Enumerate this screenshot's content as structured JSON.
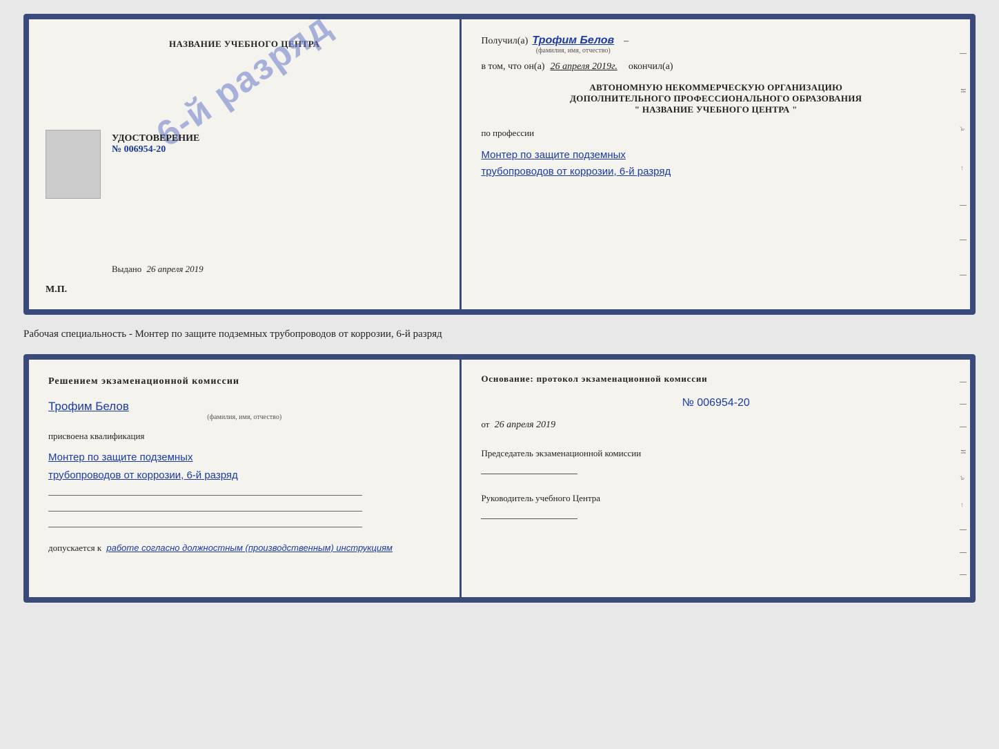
{
  "top_cert": {
    "left": {
      "school_name": "НАЗВАНИЕ УЧЕБНОГО ЦЕНТРА",
      "stamp_text": "6-й разряд",
      "udost_label": "УДОСТОВЕРЕНИЕ",
      "udost_num": "№ 006954-20",
      "vydano_label": "Выдано",
      "vydano_date": "26 апреля 2019",
      "mp_label": "М.П."
    },
    "right": {
      "poluchil_label": "Получил(а)",
      "poluchil_name": "Трофим Белов",
      "fio_sub": "(фамилия, имя, отчество)",
      "vtom_label": "в том, что он(а)",
      "vtom_date": "26 апреля 2019г.",
      "okonchil": "окончил(а)",
      "org_line1": "АВТОНОМНУЮ НЕКОММЕРЧЕСКУЮ ОРГАНИЗАЦИЮ",
      "org_line2": "ДОПОЛНИТЕЛЬНОГО ПРОФЕССИОНАЛЬНОГО ОБРАЗОВАНИЯ",
      "org_line3": "\"  НАЗВАНИЕ УЧЕБНОГО ЦЕНТРА  \"",
      "po_professii": "по профессии",
      "profession_line1": "Монтер по защите подземных",
      "profession_line2": "трубопроводов от коррозии, 6-й разряд"
    }
  },
  "worker_specialty": "Рабочая специальность - Монтер по защите подземных трубопроводов от коррозии, 6-й разряд",
  "bottom_cert": {
    "left": {
      "reshenie_text": "Решением  экзаменационной  комиссии",
      "name_hw": "Трофим Белов",
      "fio_sub": "(фамилия, имя, отчество)",
      "prisvoena": "присвоена квалификация",
      "qualification_line1": "Монтер по защите подземных",
      "qualification_line2": "трубопроводов от коррозии, 6-й разряд",
      "dopusk_label": "допускается к",
      "dopusk_text": "работе согласно должностным (производственным) инструкциям"
    },
    "right": {
      "osnovanie_label": "Основание: протокол экзаменационной  комиссии",
      "prot_num": "№  006954-20",
      "ot_label": "от",
      "ot_date": "26 апреля 2019",
      "predsedatel_label": "Председатель экзаменационной комиссии",
      "rukov_label": "Руководитель учебного Центра"
    }
  }
}
